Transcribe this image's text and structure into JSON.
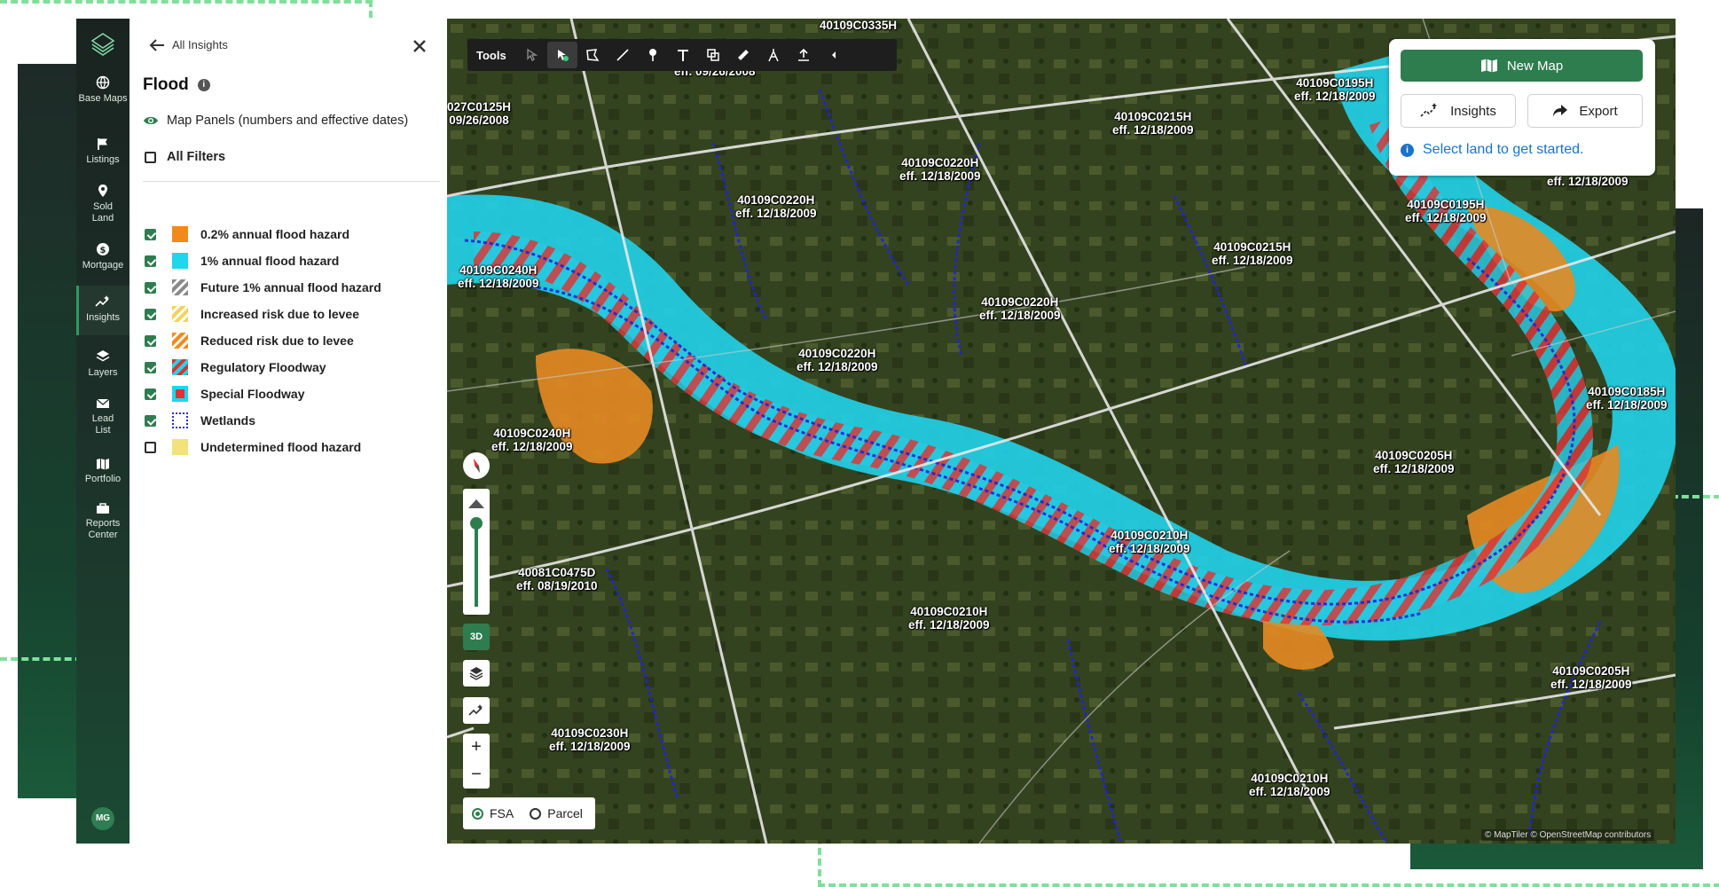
{
  "rail": {
    "items": [
      {
        "label": "Base Maps",
        "icon": "globe-icon"
      },
      {
        "label": "Listings",
        "icon": "flag-icon"
      },
      {
        "label": "Sold Land",
        "icon": "map-pin-icon"
      },
      {
        "label": "Mortgage",
        "icon": "dollar-coin-icon"
      },
      {
        "label": "Insights",
        "icon": "sparkle-chart-icon"
      },
      {
        "label": "Layers",
        "icon": "layers-icon"
      },
      {
        "label": "Lead List",
        "icon": "mail-icon"
      },
      {
        "label": "Portfolio",
        "icon": "map-book-icon"
      },
      {
        "label": "Reports Center",
        "icon": "briefcase-icon"
      }
    ],
    "active": "Insights",
    "avatar": "MG"
  },
  "panel": {
    "back_label": "All Insights",
    "title": "Flood",
    "map_panels_label": "Map Panels (numbers and effective dates)",
    "all_filters_label": "All Filters",
    "legend": [
      {
        "label": "0.2% annual flood hazard",
        "checked": true,
        "swatch": "orange",
        "color": "#f08a1c"
      },
      {
        "label": "1% annual flood hazard",
        "checked": true,
        "swatch": "cyan",
        "color": "#1fd6ee"
      },
      {
        "label": "Future 1% annual flood hazard",
        "checked": true,
        "swatch": "gray-stripe",
        "color": "#8a8a8a"
      },
      {
        "label": "Increased risk due to levee",
        "checked": true,
        "swatch": "yellow-stripe",
        "color": "#f3d35a"
      },
      {
        "label": "Reduced risk due to levee",
        "checked": true,
        "swatch": "orange-stripe",
        "color": "#f08a1c"
      },
      {
        "label": "Regulatory Floodway",
        "checked": true,
        "swatch": "red-cyan-stripe",
        "color": "#e0322f"
      },
      {
        "label": "Special Floodway",
        "checked": true,
        "swatch": "red-diamond",
        "color": "#e0322f"
      },
      {
        "label": "Wetlands",
        "checked": true,
        "swatch": "blue-dotted",
        "color": "#2a2ad0"
      },
      {
        "label": "Undetermined flood hazard",
        "checked": false,
        "swatch": "pale-yellow",
        "color": "#f2e27a"
      }
    ]
  },
  "toolbar": {
    "label": "Tools",
    "buttons": [
      "select-lasso-icon",
      "pointer-icon",
      "polygon-icon",
      "line-icon",
      "marker-icon",
      "text-icon",
      "shapes-icon",
      "ruler-icon",
      "compass-draw-icon",
      "upload-icon",
      "collapse-icon"
    ]
  },
  "actions": {
    "new_map": "New Map",
    "insights": "Insights",
    "export": "Export",
    "hint": "Select land to get started."
  },
  "map": {
    "panels": [
      {
        "id": "40109C0335H",
        "date": ""
      },
      {
        "id": "027C0125H",
        "date": "09/26/2008"
      },
      {
        "id": "",
        "date": "eff. 09/26/2008"
      },
      {
        "id": "40109C0195H",
        "date": "eff. 12/18/2009"
      },
      {
        "id": "40109C0215H",
        "date": "eff. 12/18/2009"
      },
      {
        "id": "40109C0220H",
        "date": "eff. 12/18/2009"
      },
      {
        "id": "40109C0220H",
        "date": "eff. 12/18/2009"
      },
      {
        "id": "40109C0195H",
        "date": "eff. 12/18/2009"
      },
      {
        "id": "",
        "date": "eff. 12/18/2009"
      },
      {
        "id": "40109C0215H",
        "date": "eff. 12/18/2009"
      },
      {
        "id": "40109C0240H",
        "date": "eff. 12/18/2009"
      },
      {
        "id": "40109C0220H",
        "date": "eff. 12/18/2009"
      },
      {
        "id": "40109C0220H",
        "date": "eff. 12/18/2009"
      },
      {
        "id": "40109C0185H",
        "date": "eff. 12/18/2009"
      },
      {
        "id": "40109C0240H",
        "date": "eff. 12/18/2009"
      },
      {
        "id": "40109C0205H",
        "date": "eff. 12/18/2009"
      },
      {
        "id": "40109C0210H",
        "date": "eff. 12/18/2009"
      },
      {
        "id": "40081C0475D",
        "date": "eff. 08/19/2010"
      },
      {
        "id": "40109C0210H",
        "date": "eff. 12/18/2009"
      },
      {
        "id": "40109C0205H",
        "date": "eff. 12/18/2009"
      },
      {
        "id": "40109C0230H",
        "date": "eff. 12/18/2009"
      },
      {
        "id": "40109C0210H",
        "date": "eff. 12/18/2009"
      }
    ],
    "controls": {
      "three_d": "3D",
      "zoom_in": "+",
      "zoom_out": "−"
    },
    "mode": {
      "fsa": "FSA",
      "parcel": "Parcel",
      "selected": "FSA"
    },
    "attribution": "© MapTiler © OpenStreetMap contributors"
  }
}
